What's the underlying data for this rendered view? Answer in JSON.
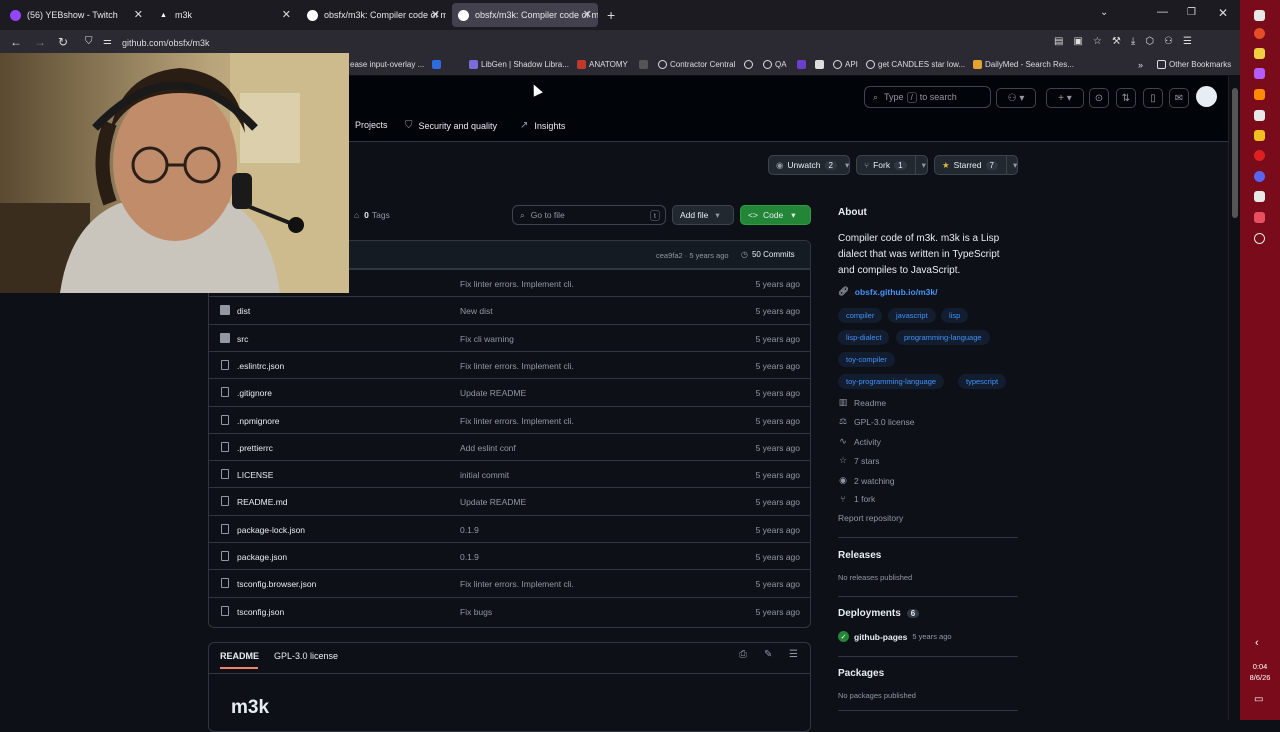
{
  "tabs": [
    {
      "label": "(56) YEBshow - Twitch",
      "icon_color": "#9146ff"
    },
    {
      "label": "m3k",
      "icon_color": "#ffffff"
    },
    {
      "label": "obsfx/m3k: Compiler code of m",
      "icon_color": "#ffffff"
    },
    {
      "label": "obsfx/m3k: Compiler code of m",
      "icon_color": "#ffffff"
    }
  ],
  "url": "github.com/obsfx/m3k",
  "bookmarks": [
    "ease input-overlay ...",
    "LibGen | Shadow Libra...",
    "ANATOMY",
    "Contractor Central",
    "QA",
    "API",
    "get CANDLES star low...",
    "DailyMed - Search Res...",
    "Other Bookmarks"
  ],
  "search": {
    "prefix": "Type",
    "key": "/",
    "suffix": "to search"
  },
  "repo_nav": [
    {
      "label": "Projects",
      "icon": "table-icon"
    },
    {
      "label": "Security and quality",
      "icon": "shield-icon"
    },
    {
      "label": "Insights",
      "icon": "graph-icon"
    }
  ],
  "actions": {
    "unwatch": "Unwatch",
    "unwatch_count": "2",
    "fork": "Fork",
    "fork_count": "1",
    "starred": "Starred",
    "starred_count": "7"
  },
  "tags": {
    "count": "0",
    "label": "Tags"
  },
  "go_to_file": "Go to file",
  "go_to_file_key": "t",
  "add_file": "Add file",
  "code": "Code",
  "latest_commit": {
    "hash": "cea9fa2",
    "age": "5 years ago",
    "commits": "50 Commits"
  },
  "files": [
    {
      "name": "",
      "message": "Fix linter errors. Implement cli.",
      "date": "5 years ago",
      "type": "folder"
    },
    {
      "name": "dist",
      "message": "New dist",
      "date": "5 years ago",
      "type": "folder"
    },
    {
      "name": "src",
      "message": "Fix cli warning",
      "date": "5 years ago",
      "type": "folder"
    },
    {
      "name": ".eslintrc.json",
      "message": "Fix linter errors. Implement cli.",
      "date": "5 years ago",
      "type": "file"
    },
    {
      "name": ".gitignore",
      "message": "Update README",
      "date": "5 years ago",
      "type": "file"
    },
    {
      "name": ".npmignore",
      "message": "Fix linter errors. Implement cli.",
      "date": "5 years ago",
      "type": "file"
    },
    {
      "name": ".prettierrc",
      "message": "Add eslint conf",
      "date": "5 years ago",
      "type": "file"
    },
    {
      "name": "LICENSE",
      "message": "initial commit",
      "date": "5 years ago",
      "type": "file"
    },
    {
      "name": "README.md",
      "message": "Update README",
      "date": "5 years ago",
      "type": "file"
    },
    {
      "name": "package-lock.json",
      "message": "0.1.9",
      "date": "5 years ago",
      "type": "file"
    },
    {
      "name": "package.json",
      "message": "0.1.9",
      "date": "5 years ago",
      "type": "file"
    },
    {
      "name": "tsconfig.browser.json",
      "message": "Fix linter errors. Implement cli.",
      "date": "5 years ago",
      "type": "file"
    },
    {
      "name": "tsconfig.json",
      "message": "Fix bugs",
      "date": "5 years ago",
      "type": "file"
    }
  ],
  "readme_tabs": {
    "readme": "README",
    "license": "GPL-3.0 license"
  },
  "readme_title": "m3k",
  "about": {
    "title": "About",
    "description_lines": [
      "Compiler code of m3k. m3k is a Lisp",
      "dialect that was written in TypeScript",
      "and compiles to JavaScript."
    ],
    "link": "obsfx.github.io/m3k/",
    "topics": [
      "compiler",
      "javascript",
      "lisp",
      "lisp-dialect",
      "programming-language",
      "toy-compiler",
      "toy-programming-language",
      "typescript"
    ],
    "readme": "Readme",
    "license": "GPL-3.0 license",
    "activity": "Activity",
    "stars": "7 stars",
    "watching": "2 watching",
    "forks": "1 fork",
    "report": "Report repository"
  },
  "releases": {
    "title": "Releases",
    "text": "No releases published"
  },
  "deployments": {
    "title": "Deployments",
    "count": "6",
    "item": "github-pages",
    "age": "5 years ago"
  },
  "packages": {
    "title": "Packages",
    "text": "No packages published"
  },
  "clock": {
    "time": "0:04",
    "date": "8/6/26"
  },
  "colors": {
    "accent_green": "#238636",
    "link_blue": "#4493f8",
    "sidebar_red": "#7a0b1b"
  }
}
